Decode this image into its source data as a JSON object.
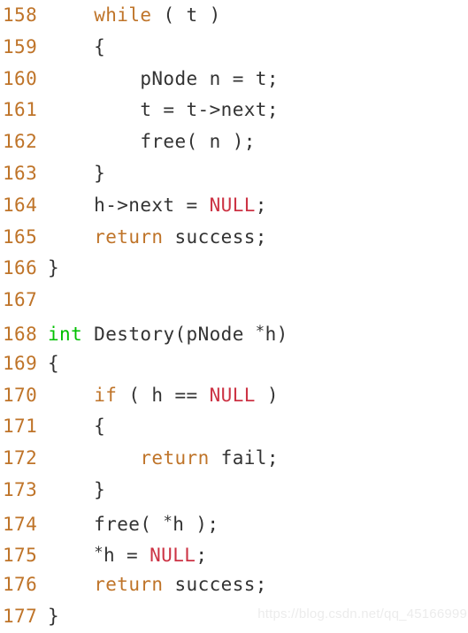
{
  "editor": {
    "language": "c",
    "background_color": "#ffffff",
    "line_number_color": "#bf7429",
    "colors": {
      "plain": "#333333",
      "keyword": "#bf7429",
      "type": "#00c000",
      "constant": "#cc3344"
    },
    "first_line_number": 158,
    "last_line_number": 177,
    "lines": [
      {
        "number": "158",
        "text": "    while ( t )",
        "tokens": [
          {
            "t": "    ",
            "k": "plain"
          },
          {
            "t": "while",
            "k": "keyword"
          },
          {
            "t": " ( t )",
            "k": "plain"
          }
        ]
      },
      {
        "number": "159",
        "text": "    {",
        "tokens": [
          {
            "t": "    {",
            "k": "plain"
          }
        ]
      },
      {
        "number": "160",
        "text": "        pNode n = t;",
        "tokens": [
          {
            "t": "        pNode n = t;",
            "k": "plain"
          }
        ]
      },
      {
        "number": "161",
        "text": "        t = t->next;",
        "tokens": [
          {
            "t": "        t = t->next;",
            "k": "plain"
          }
        ]
      },
      {
        "number": "162",
        "text": "        free( n );",
        "tokens": [
          {
            "t": "        free( n );",
            "k": "plain"
          }
        ]
      },
      {
        "number": "163",
        "text": "    }",
        "tokens": [
          {
            "t": "    }",
            "k": "plain"
          }
        ]
      },
      {
        "number": "164",
        "text": "    h->next = NULL;",
        "tokens": [
          {
            "t": "    h->next = ",
            "k": "plain"
          },
          {
            "t": "NULL",
            "k": "constant"
          },
          {
            "t": ";",
            "k": "plain"
          }
        ]
      },
      {
        "number": "165",
        "text": "    return success;",
        "tokens": [
          {
            "t": "    ",
            "k": "plain"
          },
          {
            "t": "return",
            "k": "keyword"
          },
          {
            "t": " success;",
            "k": "plain"
          }
        ]
      },
      {
        "number": "166",
        "text": "}",
        "tokens": [
          {
            "t": "}",
            "k": "plain"
          }
        ]
      },
      {
        "number": "167",
        "text": "",
        "tokens": []
      },
      {
        "number": "168",
        "text": "int Destory(pNode *h)",
        "tokens": [
          {
            "t": "int",
            "k": "type"
          },
          {
            "t": " Destory(pNode ",
            "k": "plain"
          },
          {
            "t": "*",
            "k": "plain",
            "star": true
          },
          {
            "t": "h)",
            "k": "plain"
          }
        ]
      },
      {
        "number": "169",
        "text": "{",
        "tokens": [
          {
            "t": "{",
            "k": "plain"
          }
        ]
      },
      {
        "number": "170",
        "text": "    if ( h == NULL )",
        "tokens": [
          {
            "t": "    ",
            "k": "plain"
          },
          {
            "t": "if",
            "k": "keyword"
          },
          {
            "t": " ( h == ",
            "k": "plain"
          },
          {
            "t": "NULL",
            "k": "constant"
          },
          {
            "t": " )",
            "k": "plain"
          }
        ]
      },
      {
        "number": "171",
        "text": "    {",
        "tokens": [
          {
            "t": "    {",
            "k": "plain"
          }
        ]
      },
      {
        "number": "172",
        "text": "        return fail;",
        "tokens": [
          {
            "t": "        ",
            "k": "plain"
          },
          {
            "t": "return",
            "k": "keyword"
          },
          {
            "t": " fail;",
            "k": "plain"
          }
        ]
      },
      {
        "number": "173",
        "text": "    }",
        "tokens": [
          {
            "t": "    }",
            "k": "plain"
          }
        ]
      },
      {
        "number": "174",
        "text": "    free( *h );",
        "tokens": [
          {
            "t": "    free( ",
            "k": "plain"
          },
          {
            "t": "*",
            "k": "plain",
            "star": true
          },
          {
            "t": "h );",
            "k": "plain"
          }
        ]
      },
      {
        "number": "175",
        "text": "    *h = NULL;",
        "tokens": [
          {
            "t": "    ",
            "k": "plain"
          },
          {
            "t": "*",
            "k": "plain",
            "star": true
          },
          {
            "t": "h = ",
            "k": "plain"
          },
          {
            "t": "NULL",
            "k": "constant"
          },
          {
            "t": ";",
            "k": "plain"
          }
        ]
      },
      {
        "number": "176",
        "text": "    return success;",
        "tokens": [
          {
            "t": "    ",
            "k": "plain"
          },
          {
            "t": "return",
            "k": "keyword"
          },
          {
            "t": " success;",
            "k": "plain"
          }
        ]
      },
      {
        "number": "177",
        "text": "}",
        "tokens": [
          {
            "t": "}",
            "k": "plain"
          }
        ]
      }
    ]
  },
  "watermark": {
    "text": "https://blog.csdn.net/qq_45166999",
    "color": "#ececec"
  }
}
